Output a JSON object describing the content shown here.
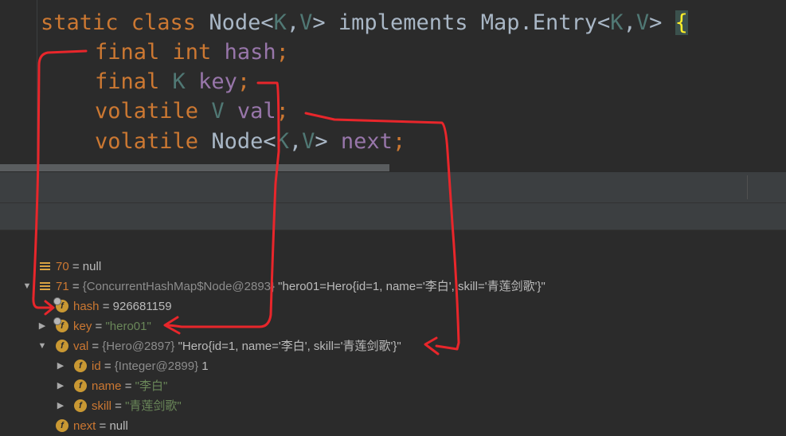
{
  "code": {
    "line1": {
      "t1": "static class ",
      "t2": "Node<",
      "t3": "K",
      "t4": ",",
      "t5": "V",
      "t6": "> implements ",
      "t7": "Map.Entry<",
      "t8": "K",
      "t9": ",",
      "t10": "V",
      "t11": "> ",
      "brace": "{"
    },
    "line2": {
      "kw": "final int ",
      "field": "hash",
      "semi": ";"
    },
    "line3": {
      "kw": "final ",
      "type": "K ",
      "field": "key",
      "semi": ";"
    },
    "line4": {
      "kw": "volatile ",
      "type": "V ",
      "field": "val",
      "semi": ";"
    },
    "line5": {
      "kw": "volatile ",
      "cls1": "Node<",
      "tk": "K",
      "comma": ",",
      "tv": "V",
      "cls2": "> ",
      "field": "next",
      "semi": ";"
    }
  },
  "variables": {
    "row70": {
      "name": "70",
      "eq": " = ",
      "value": "null"
    },
    "row71": {
      "name": "71",
      "eq": " = ",
      "ref": "{ConcurrentHashMap$Node@2893}",
      "value": " \"hero01=Hero{id=1, name='李白', skill='青莲剑歌'}\""
    },
    "hash": {
      "name": "hash",
      "eq": " = ",
      "value": "926681159"
    },
    "key": {
      "name": "key",
      "eq": " = ",
      "value": "\"hero01\""
    },
    "val": {
      "name": "val",
      "eq": " = ",
      "ref": "{Hero@2897}",
      "value": " \"Hero{id=1, name='李白', skill='青莲剑歌'}\""
    },
    "id": {
      "name": "id",
      "eq": " = ",
      "ref": "{Integer@2899}",
      "value": " 1"
    },
    "nameField": {
      "name": "name",
      "eq": " = ",
      "value": "\"李白\""
    },
    "skill": {
      "name": "skill",
      "eq": " = ",
      "value": "\"青莲剑歌\""
    },
    "next": {
      "name": "next",
      "eq": " = ",
      "value": "null"
    }
  },
  "icons": {
    "list": "array-icon",
    "field": "field-icon",
    "field_letter": "f"
  },
  "colors": {
    "keyword": "#cc7832",
    "field": "#9876aa",
    "type_param": "#507874",
    "string": "#6a8759",
    "annotation_red": "#e8262b"
  }
}
